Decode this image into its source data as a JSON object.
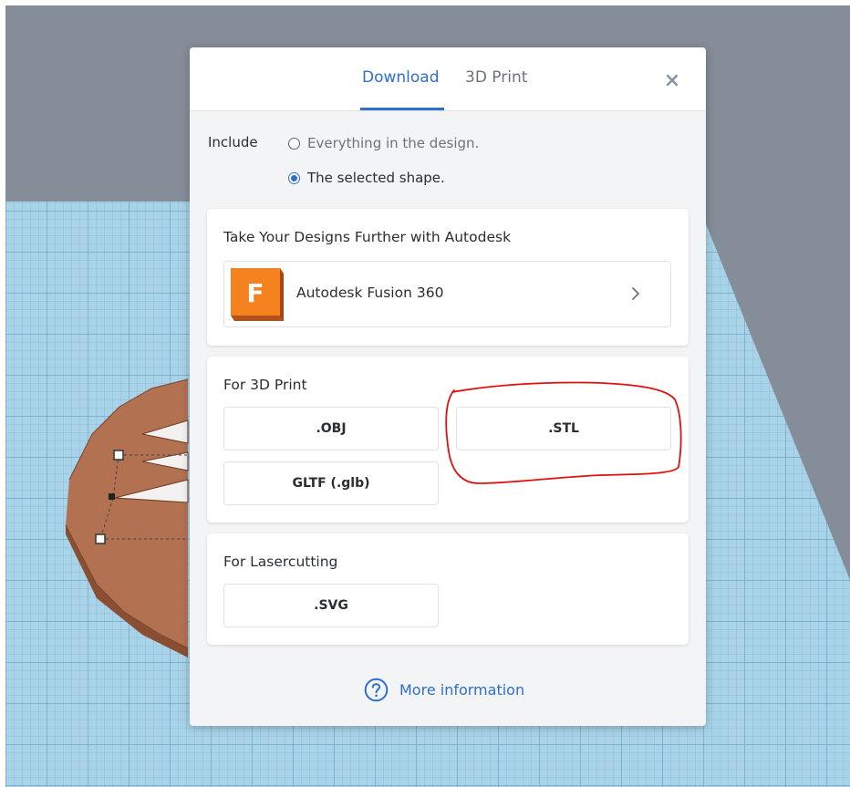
{
  "tabs": [
    {
      "label": "Download",
      "active": true
    },
    {
      "label": "3D Print",
      "active": false
    }
  ],
  "close_icon": "close-icon",
  "include": {
    "label": "Include",
    "options": [
      {
        "label": "Everything in the design.",
        "selected": false
      },
      {
        "label": "The selected shape.",
        "selected": true
      }
    ]
  },
  "autodesk_card": {
    "title": "Take Your Designs Further with Autodesk",
    "app": {
      "logo_letter": "F",
      "label": "Autodesk Fusion 360",
      "icon": "chevron-right-icon"
    }
  },
  "print_card": {
    "title": "For 3D Print",
    "buttons": [
      ".OBJ",
      ".STL",
      "GLTF (.glb)"
    ]
  },
  "laser_card": {
    "title": "For Lasercutting",
    "buttons": [
      ".SVG"
    ]
  },
  "more_info": {
    "label": "More information",
    "icon": "help-circle-icon"
  },
  "colors": {
    "accent": "#2f6fc9",
    "annotation": "#e01010",
    "fusion_orange": "#f5821f",
    "workplane": "#a6d4ea",
    "background": "#858d98"
  }
}
